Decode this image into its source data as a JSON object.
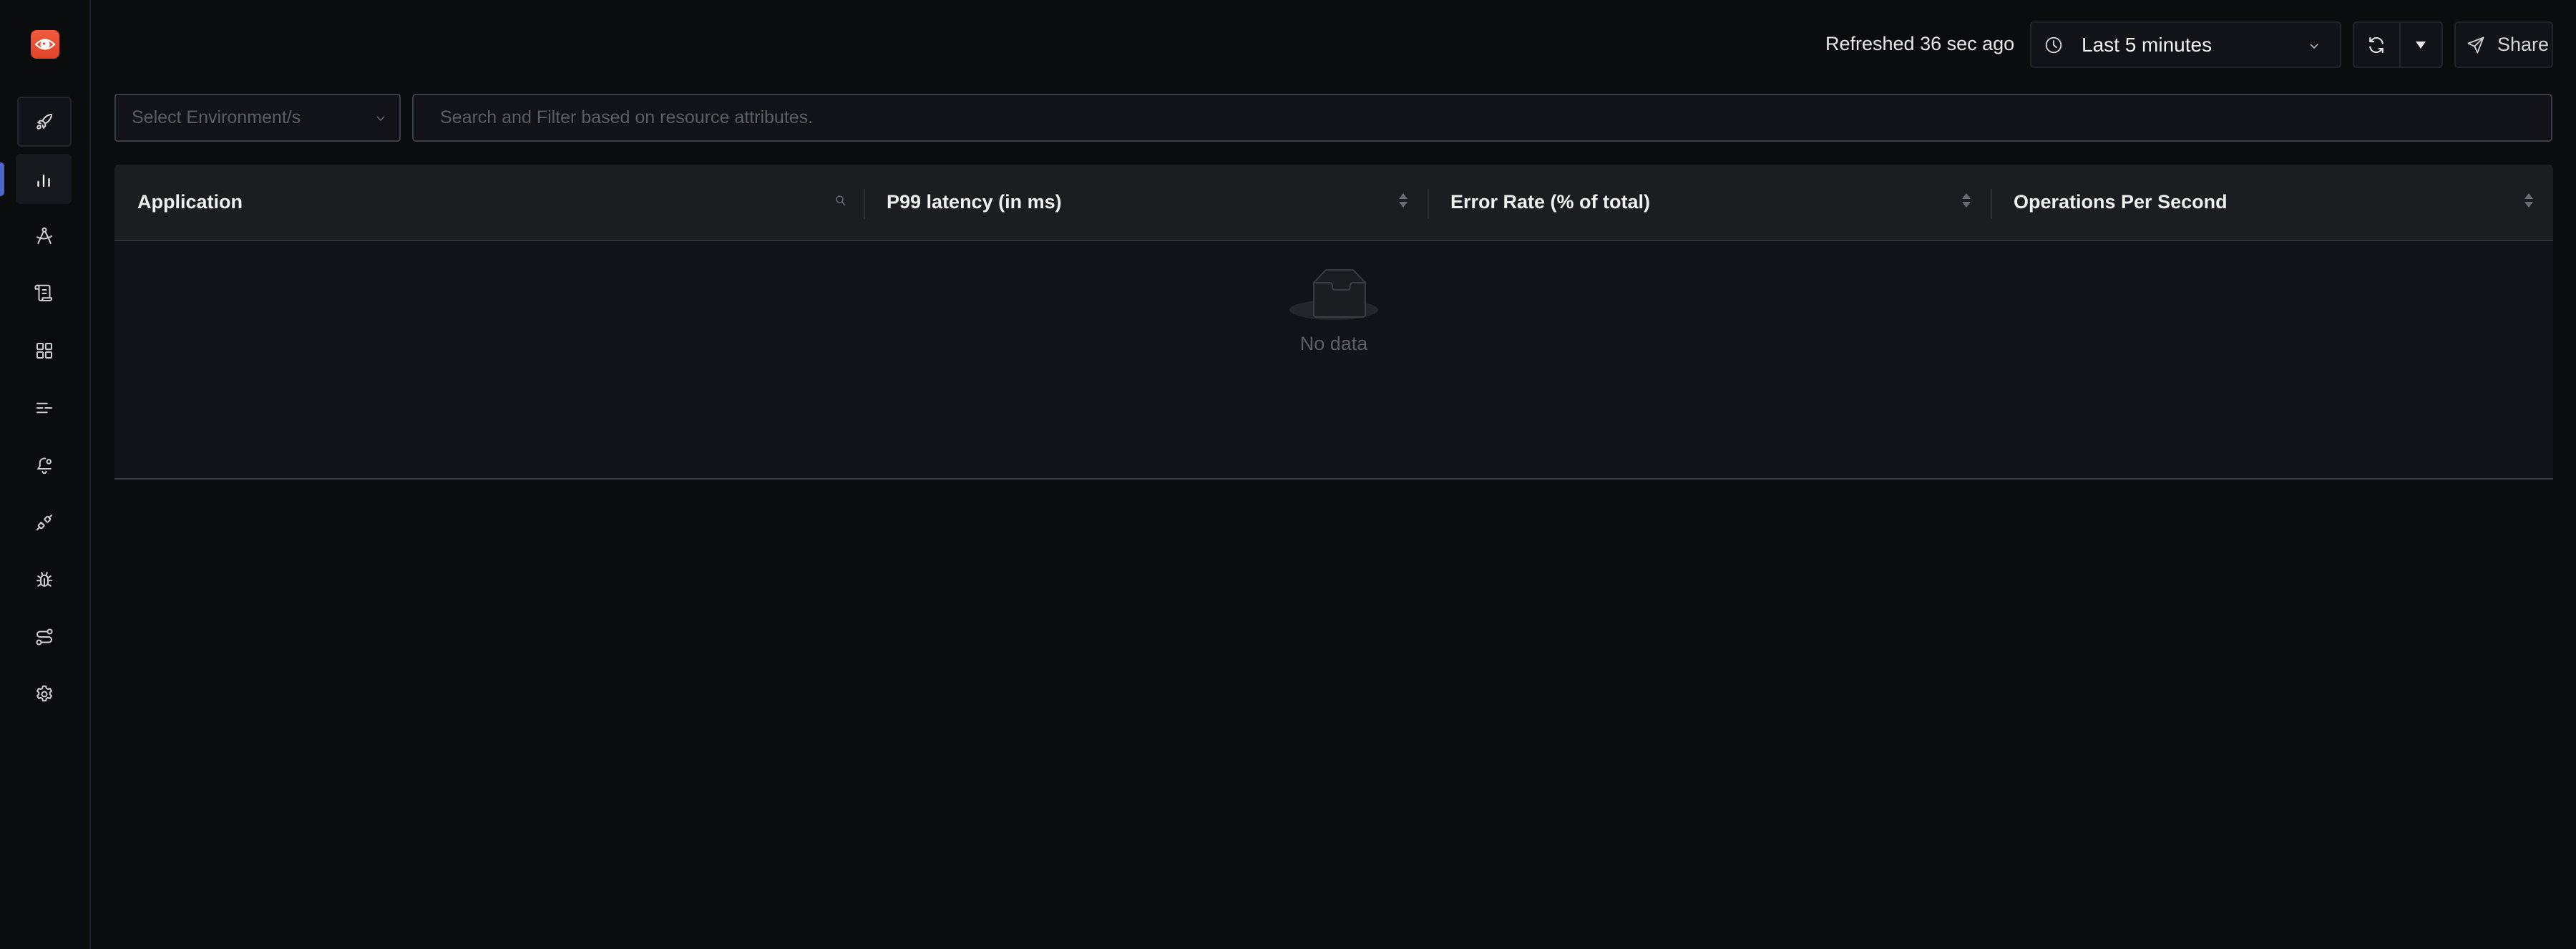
{
  "sidebar": {
    "logo": "eye-logo",
    "items": [
      {
        "name": "get-started",
        "icon": "rocket-icon",
        "state": "boxed"
      },
      {
        "name": "services",
        "icon": "bar-chart-icon",
        "state": "active"
      },
      {
        "name": "service-map",
        "icon": "compass-icon",
        "state": "default"
      },
      {
        "name": "logs",
        "icon": "scroll-icon",
        "state": "default"
      },
      {
        "name": "dashboards",
        "icon": "grid-icon",
        "state": "default"
      },
      {
        "name": "traces",
        "icon": "list-icon",
        "state": "default"
      },
      {
        "name": "alerts",
        "icon": "bell-icon",
        "state": "default"
      },
      {
        "name": "integrations",
        "icon": "plug-icon",
        "state": "default"
      },
      {
        "name": "exceptions",
        "icon": "bug-icon",
        "state": "default"
      },
      {
        "name": "pipelines",
        "icon": "route-icon",
        "state": "default"
      },
      {
        "name": "settings",
        "icon": "gear-icon",
        "state": "default"
      }
    ],
    "accent": "#4e64cf"
  },
  "header": {
    "refreshed_text": "Refreshed 36 sec ago",
    "time_range": "Last 5 minutes",
    "share_label": "Share"
  },
  "filters": {
    "environment_placeholder": "Select Environment/s",
    "search_placeholder": "Search and Filter based on resource attributes.",
    "search_value": ""
  },
  "table": {
    "columns": [
      {
        "label": "Application",
        "control": "search"
      },
      {
        "label": "P99 latency (in ms)",
        "control": "sort"
      },
      {
        "label": "Error Rate (% of total)",
        "control": "sort"
      },
      {
        "label": "Operations Per Second",
        "control": "sort"
      }
    ],
    "rows": [],
    "empty_text": "No data"
  }
}
